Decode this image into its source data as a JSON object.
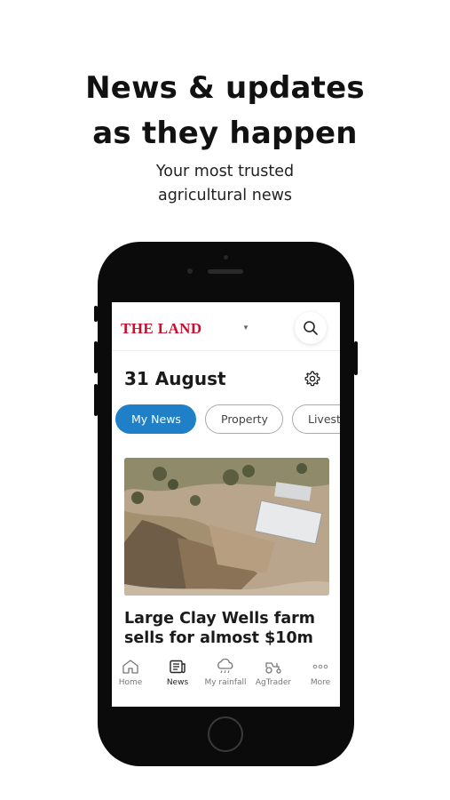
{
  "promo": {
    "headline_line1": "News & updates",
    "headline_line2": "as they happen",
    "subline_line1": "Your most trusted",
    "subline_line2": "agricultural news"
  },
  "app": {
    "logo_text": "THE LAND",
    "logo_color": "#c8102e",
    "accent_color": "#1f7fc7",
    "date": "31 August",
    "chips": [
      {
        "label": "My News",
        "active": true
      },
      {
        "label": "Property",
        "active": false
      },
      {
        "label": "Livest",
        "active": false
      }
    ],
    "article": {
      "title_line1": "Large Clay Wells farm",
      "title_line2": "sells for almost $10m",
      "image": "aerial-farm-sheep-yards"
    },
    "tabs": [
      {
        "label": "Home",
        "icon": "home-icon",
        "active": false
      },
      {
        "label": "News",
        "icon": "news-icon",
        "active": true
      },
      {
        "label": "My rainfall",
        "icon": "rain-cloud-icon",
        "active": false
      },
      {
        "label": "AgTrader",
        "icon": "tractor-icon",
        "active": false
      },
      {
        "label": "More",
        "icon": "more-dots-icon",
        "active": false
      }
    ]
  }
}
